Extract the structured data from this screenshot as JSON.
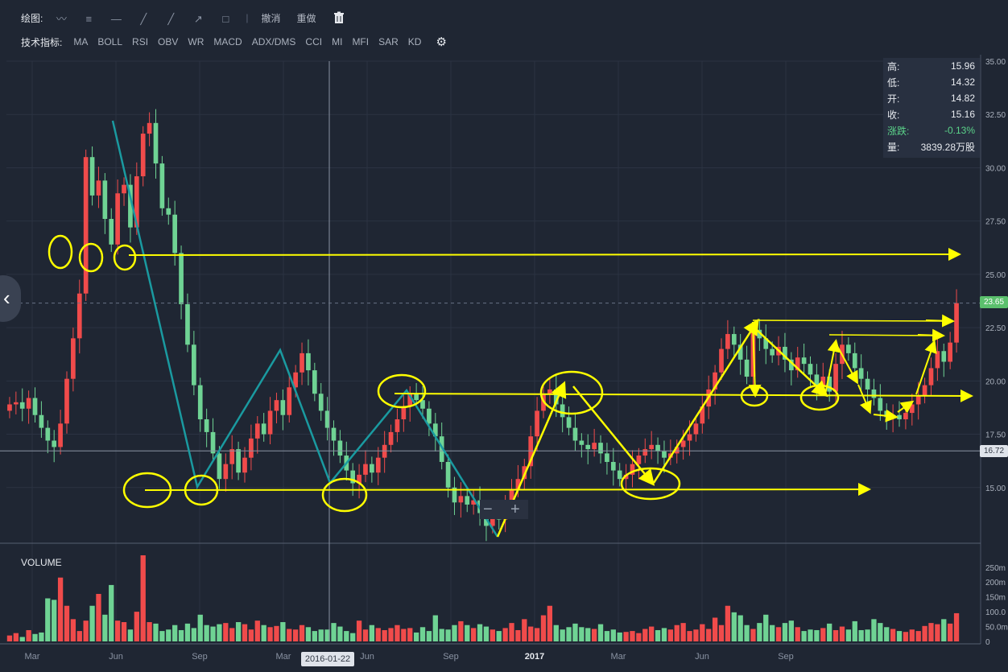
{
  "toolbar": {
    "draw_label": "绘图:",
    "undo_label": "撤消",
    "redo_label": "重做",
    "indicator_label": "技术指标:",
    "indicators": [
      "MA",
      "BOLL",
      "RSI",
      "OBV",
      "WR",
      "MACD",
      "ADX/DMS",
      "CCI",
      "MI",
      "MFI",
      "SAR",
      "KD"
    ],
    "tools": [
      {
        "name": "freehand-icon",
        "glyph": "〰"
      },
      {
        "name": "fib-lines-icon",
        "glyph": "≡"
      },
      {
        "name": "horizontal-line-icon",
        "glyph": "—"
      },
      {
        "name": "trend-line-icon",
        "glyph": "╱"
      },
      {
        "name": "ray-line-icon",
        "glyph": "╱"
      },
      {
        "name": "arrow-line-icon",
        "glyph": "↗"
      },
      {
        "name": "rectangle-icon",
        "glyph": "□"
      }
    ],
    "trash_icon": "trash-icon",
    "gear_icon": "gear-icon"
  },
  "info_panel": {
    "rows": [
      {
        "label": "高:",
        "value": "15.96"
      },
      {
        "label": "低:",
        "value": "14.32"
      },
      {
        "label": "开:",
        "value": "14.82"
      },
      {
        "label": "收:",
        "value": "15.16"
      },
      {
        "label": "涨跌:",
        "value": "-0.13%"
      },
      {
        "label": "量:",
        "value": "3839.28万股"
      }
    ]
  },
  "crosshair": {
    "date": "2016-01-22",
    "price": "16.72"
  },
  "last_price": "23.65",
  "nav": {
    "back_icon": "chevron-left-icon",
    "zoom_out": "−",
    "zoom_in": "+"
  },
  "colors": {
    "up": "#f04b4b",
    "down": "#6fd394",
    "annotation": "#ffff00",
    "wave": "#1a9aa0",
    "background": "#1f2633",
    "grid": "#2b3342"
  },
  "chart_data": {
    "type": "candlestick",
    "price_axis": {
      "range": [
        12.5,
        35.0
      ],
      "ticks": [
        "35.00",
        "32.50",
        "30.00",
        "27.50",
        "25.00",
        "22.50",
        "20.00",
        "17.50",
        "15.00"
      ]
    },
    "volume_title": "VOLUME",
    "volume_axis": {
      "range": [
        0,
        290
      ],
      "ticks": [
        "250m",
        "200m",
        "150m",
        "100.0",
        "50.0m",
        "0"
      ]
    },
    "time_labels": [
      "Mar",
      "Jun",
      "Sep",
      "Mar",
      "Jun",
      "Sep",
      "2017",
      "Mar",
      "Jun",
      "Sep"
    ],
    "closes": [
      18.9,
      19.0,
      18.7,
      19.2,
      18.4,
      17.8,
      17.2,
      16.9,
      18.0,
      20.1,
      22.0,
      24.1,
      30.5,
      28.7,
      29.4,
      27.6,
      26.4,
      28.8,
      29.2,
      27.2,
      29.6,
      31.6,
      32.1,
      30.2,
      28.1,
      27.8,
      26.0,
      23.6,
      21.7,
      19.8,
      18.2,
      17.6,
      16.6,
      15.4,
      16.1,
      16.8,
      15.7,
      16.4,
      17.3,
      18.0,
      17.5,
      18.6,
      19.1,
      18.4,
      19.7,
      20.4,
      21.3,
      20.5,
      19.4,
      18.6,
      17.8,
      17.2,
      16.5,
      15.8,
      15.2,
      15.6,
      16.1,
      15.7,
      16.4,
      17.0,
      17.6,
      18.2,
      18.8,
      19.4,
      19.1,
      18.7,
      18.0,
      17.4,
      16.2,
      15.0,
      14.3,
      14.6,
      14.2,
      14.4,
      13.8,
      13.2,
      13.6,
      13.5,
      14.3,
      14.9,
      15.4,
      16.0,
      17.4,
      18.6,
      19.4,
      19.6,
      18.9,
      18.3,
      17.8,
      17.2,
      17.0,
      16.8,
      17.1,
      16.6,
      16.2,
      15.8,
      15.4,
      15.6,
      16.1,
      16.5,
      16.8,
      17.0,
      16.7,
      16.4,
      16.6,
      16.9,
      17.2,
      17.5,
      18.0,
      18.8,
      19.6,
      20.4,
      21.5,
      22.2,
      21.7,
      21.0,
      20.2,
      22.4,
      22.0,
      21.5,
      21.2,
      21.6,
      21.0,
      20.5,
      21.1,
      20.8,
      20.3,
      19.8,
      20.2,
      19.5,
      20.8,
      21.7,
      21.3,
      20.6,
      20.1,
      19.6,
      19.2,
      18.6,
      18.3,
      18.4,
      18.2,
      18.5,
      18.9,
      19.3,
      19.8,
      20.6,
      21.4,
      20.9,
      21.8,
      23.65
    ],
    "volumes": [
      20,
      28,
      15,
      38,
      25,
      30,
      145,
      140,
      215,
      120,
      75,
      35,
      70,
      120,
      160,
      90,
      190,
      70,
      65,
      40,
      100,
      290,
      65,
      60,
      35,
      40,
      55,
      38,
      60,
      45,
      90,
      55,
      50,
      58,
      62,
      45,
      65,
      58,
      40,
      70,
      55,
      48,
      52,
      65,
      42,
      40,
      55,
      48,
      35,
      40,
      40,
      62,
      50,
      35,
      28,
      70,
      40,
      55,
      45,
      38,
      45,
      55,
      42,
      45,
      30,
      48,
      35,
      88,
      42,
      40,
      55,
      68,
      55,
      45,
      58,
      50,
      40,
      35,
      45,
      62,
      38,
      75,
      50,
      45,
      88,
      120,
      55,
      40,
      48,
      60,
      48,
      45,
      42,
      58,
      35,
      40,
      30,
      32,
      35,
      28,
      42,
      50,
      38,
      45,
      40,
      55,
      62,
      35,
      40,
      58,
      42,
      80,
      55,
      120,
      98,
      88,
      55,
      42,
      62,
      90,
      55,
      48,
      62,
      70,
      48,
      35,
      40,
      38,
      45,
      60,
      38,
      50,
      40,
      68,
      38,
      40,
      75,
      62,
      48,
      42,
      35,
      32,
      40,
      35,
      52,
      62,
      58,
      75,
      60,
      95,
      78,
      98
    ]
  }
}
